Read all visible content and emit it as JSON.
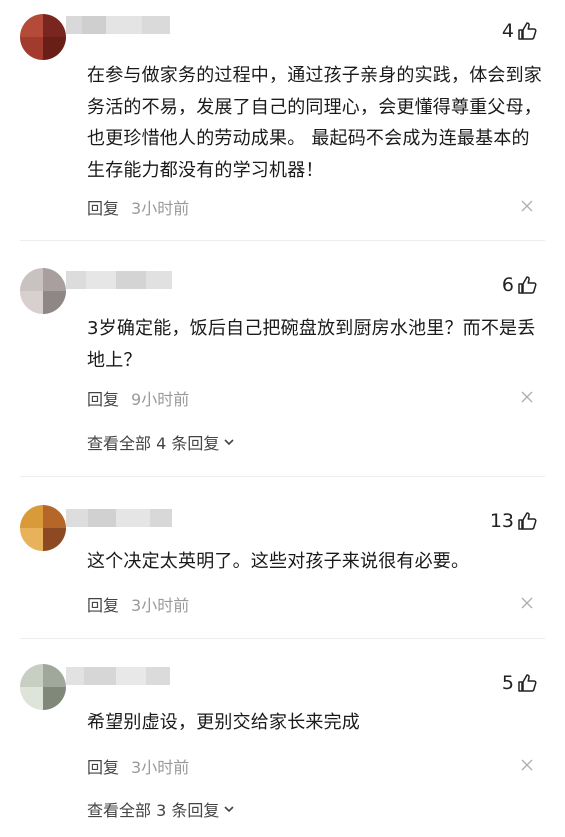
{
  "comments": [
    {
      "likes": "4",
      "text": "在参与做家务的过程中，通过孩子亲身的实践，体会到家务活的不易，发展了自己的同理心，会更懂得尊重父母，也更珍惜他人的劳动成果。 最起码不会成为连最基本的生存能力都没有的学习机器！",
      "reply_label": "回复",
      "time": "3小时前",
      "avatar_colors": [
        "#b44a3a",
        "#7a2620",
        "#a23a2e",
        "#6a1e18"
      ]
    },
    {
      "likes": "6",
      "text": "3岁确定能，饭后自己把碗盘放到厨房水池里？而不是丢地上？",
      "reply_label": "回复",
      "time": "9小时前",
      "more_replies": "查看全部 4 条回复",
      "avatar_colors": [
        "#c8c2c0",
        "#a89f9e",
        "#d7d0cf",
        "#8f8786"
      ]
    },
    {
      "likes": "13",
      "text": "这个决定太英明了。这些对孩子来说很有必要。",
      "reply_label": "回复",
      "time": "3小时前",
      "avatar_colors": [
        "#d99a3a",
        "#b5672a",
        "#e8b25a",
        "#8d4a22"
      ]
    },
    {
      "likes": "5",
      "text": "希望别虚设，更别交给家长来完成",
      "reply_label": "回复",
      "time": "3小时前",
      "more_replies": "查看全部 3 条回复",
      "avatar_colors": [
        "#c7cfc3",
        "#9fa89a",
        "#dfe4db",
        "#7f8879"
      ]
    }
  ]
}
